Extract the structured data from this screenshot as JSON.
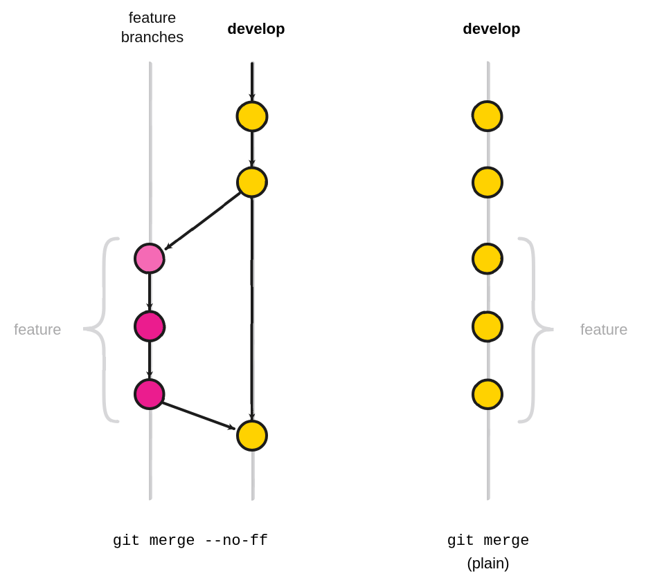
{
  "headers": {
    "feature_branches_line1": "feature",
    "feature_branches_line2": "branches",
    "develop_left": "develop",
    "develop_right": "develop"
  },
  "brace_labels": {
    "left": "feature",
    "right": "feature"
  },
  "captions": {
    "left_cmd": "git merge --no-ff",
    "right_cmd": "git merge",
    "right_sub": "(plain)"
  },
  "colors": {
    "develop_fill": "#FFD200",
    "feature_fill": "#EB1D8E",
    "feature_fill_light": "#F56BB5",
    "stroke": "#1a1a1a",
    "track": "#c9c9cb",
    "brace": "#d7d7d9"
  },
  "chart_data": {
    "type": "diagram",
    "description": "Comparison of git merge --no-ff vs plain git merge (fast-forward).",
    "left": {
      "title": "git merge --no-ff",
      "branches": [
        "feature",
        "develop"
      ],
      "develop_commits": [
        "d1",
        "d2",
        "merge"
      ],
      "feature_commits": [
        "f1",
        "f2",
        "f3"
      ],
      "edges": [
        [
          "d1",
          "d2"
        ],
        [
          "d2",
          "f1"
        ],
        [
          "d2",
          "merge"
        ],
        [
          "f1",
          "f2"
        ],
        [
          "f2",
          "f3"
        ],
        [
          "f3",
          "merge"
        ]
      ],
      "feature_brace_spans": [
        "f1",
        "f2",
        "f3"
      ]
    },
    "right": {
      "title": "git merge (plain)",
      "branches": [
        "develop"
      ],
      "develop_commits": [
        "d1",
        "d2",
        "d3",
        "d4",
        "d5"
      ],
      "edges": [
        [
          "d1",
          "d2"
        ],
        [
          "d2",
          "d3"
        ],
        [
          "d3",
          "d4"
        ],
        [
          "d4",
          "d5"
        ]
      ],
      "feature_brace_spans": [
        "d3",
        "d4",
        "d5"
      ]
    }
  }
}
